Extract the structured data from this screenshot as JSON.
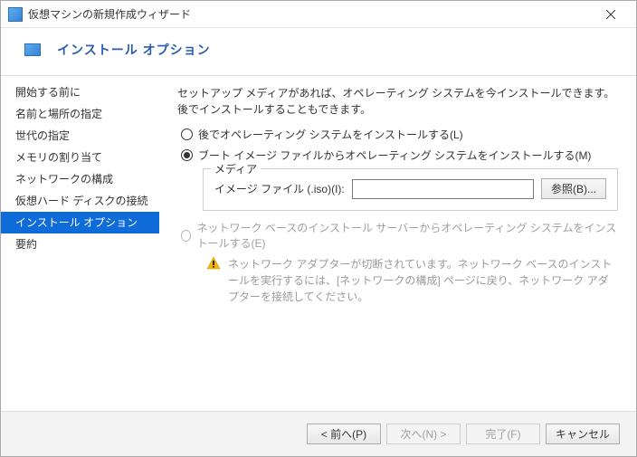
{
  "window": {
    "title": "仮想マシンの新規作成ウィザード"
  },
  "page": {
    "heading": "インストール オプション"
  },
  "sidebar": {
    "items": [
      {
        "label": "開始する前に"
      },
      {
        "label": "名前と場所の指定"
      },
      {
        "label": "世代の指定"
      },
      {
        "label": "メモリの割り当て"
      },
      {
        "label": "ネットワークの構成"
      },
      {
        "label": "仮想ハード ディスクの接続"
      },
      {
        "label": "インストール オプション"
      },
      {
        "label": "要約"
      }
    ],
    "selected_index": 6
  },
  "content": {
    "description": "セットアップ メディアがあれば、オペレーティング システムを今インストールできます。後でインストールすることもできます。",
    "option_later": "後でオペレーティング システムをインストールする(L)",
    "option_boot_image": "ブート イメージ ファイルからオペレーティング システムをインストールする(M)",
    "option_network": "ネットワーク ベースのインストール サーバーからオペレーティング システムをインストールする(E)",
    "media_group": "メディア",
    "iso_label": "イメージ ファイル (.iso)(I):",
    "iso_value": "",
    "browse_button": "参照(B)...",
    "warning_text": "ネットワーク アダプターが切断されています。ネットワーク ベースのインストールを実行するには、[ネットワークの構成] ページに戻り、ネットワーク アダプターを接続してください。"
  },
  "footer": {
    "back": "< 前へ(P)",
    "next": "次へ(N) >",
    "finish": "完了(F)",
    "cancel": "キャンセル"
  }
}
